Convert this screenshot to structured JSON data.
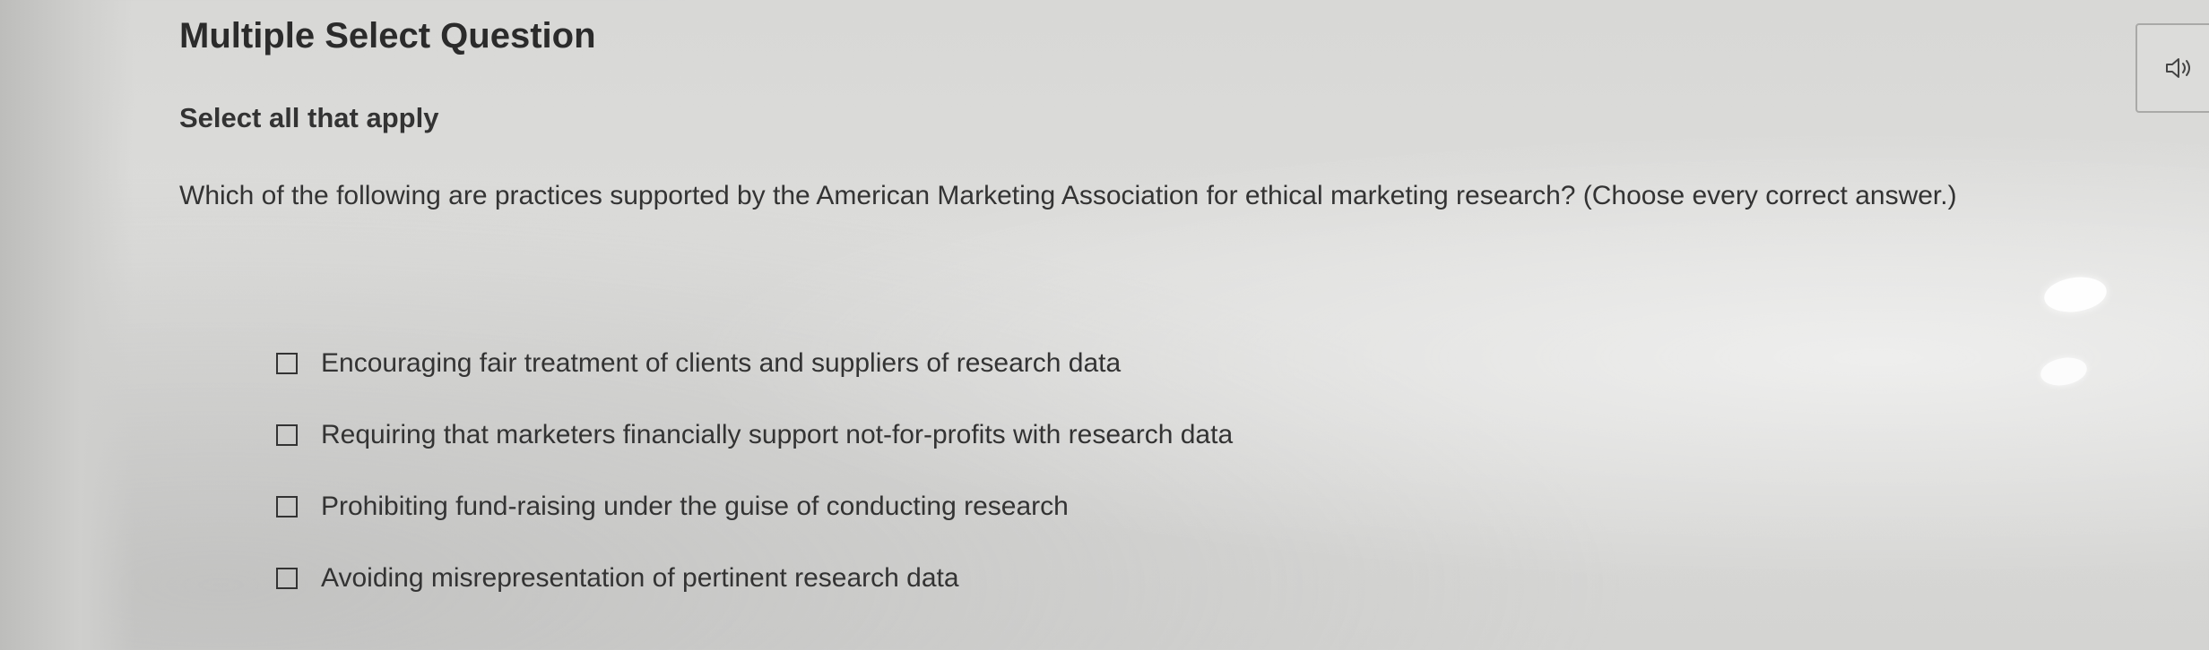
{
  "header": {
    "title": "Multiple Select Question",
    "instruction": "Select all that apply"
  },
  "question": {
    "text": "Which of the following are practices supported by the American Marketing Association for ethical marketing research? (Choose every correct answer.)"
  },
  "options": [
    {
      "label": "Encouraging fair treatment of clients and suppliers of research data",
      "checked": false
    },
    {
      "label": "Requiring that marketers financially support not-for-profits with research data",
      "checked": false
    },
    {
      "label": "Prohibiting fund-raising under the guise of conducting research",
      "checked": false
    },
    {
      "label": "Avoiding misrepresentation of pertinent research data",
      "checked": false
    }
  ],
  "toolbar": {
    "audio_icon": "speaker-icon"
  }
}
